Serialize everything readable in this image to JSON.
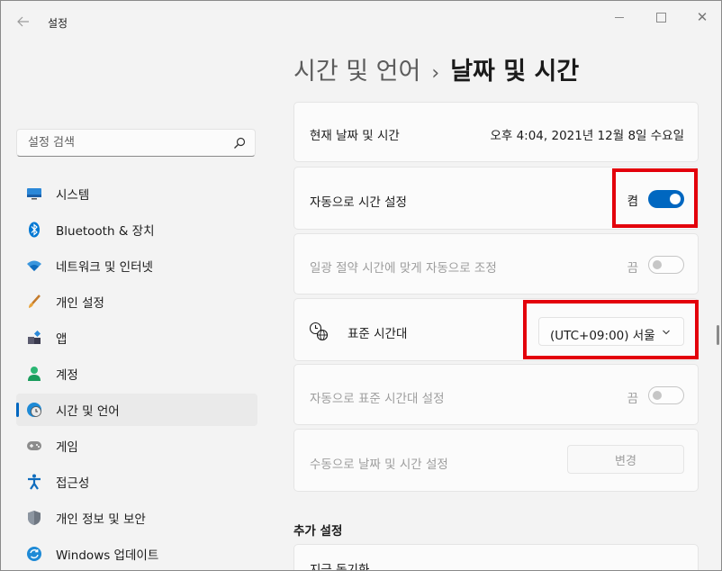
{
  "app": {
    "title": "설정"
  },
  "search": {
    "placeholder": "설정 검색"
  },
  "nav": {
    "items": [
      {
        "label": "시스템",
        "icon": "system-icon"
      },
      {
        "label": "Bluetooth & 장치",
        "icon": "bluetooth-icon"
      },
      {
        "label": "네트워크 및 인터넷",
        "icon": "wifi-icon"
      },
      {
        "label": "개인 설정",
        "icon": "brush-icon"
      },
      {
        "label": "앱",
        "icon": "apps-icon"
      },
      {
        "label": "계정",
        "icon": "account-icon"
      },
      {
        "label": "시간 및 언어",
        "icon": "time-language-icon",
        "selected": true
      },
      {
        "label": "게임",
        "icon": "gamepad-icon"
      },
      {
        "label": "접근성",
        "icon": "accessibility-icon"
      },
      {
        "label": "개인 정보 및 보안",
        "icon": "shield-icon"
      },
      {
        "label": "Windows 업데이트",
        "icon": "update-icon"
      }
    ]
  },
  "header": {
    "parent": "시간 및 언어",
    "separator": "›",
    "current": "날짜 및 시간"
  },
  "current_time": {
    "label": "현재 날짜 및 시간",
    "value": "오후 4:04, 2021년 12월 8일 수요일"
  },
  "auto_time": {
    "label": "자동으로 시간 설정",
    "state_label": "켬",
    "on": true
  },
  "dst": {
    "label": "일광 절약 시간에 맞게 자동으로 조정",
    "state_label": "끔",
    "on": false,
    "disabled": true
  },
  "timezone": {
    "label": "표준 시간대",
    "value": "(UTC+09:00) 서울",
    "icon": "clock-globe-icon"
  },
  "auto_timezone": {
    "label": "자동으로 표준 시간대 설정",
    "state_label": "끔",
    "on": false,
    "disabled": true
  },
  "manual_time": {
    "label": "수동으로 날짜 및 시간 설정",
    "button_label": "변경",
    "disabled": true
  },
  "additional": {
    "heading": "추가 설정",
    "sync_label": "지금 동기화"
  },
  "colors": {
    "accent": "#0067c0",
    "highlight": "#e3000b",
    "background": "#f3f3f3",
    "card": "#fbfbfb"
  }
}
